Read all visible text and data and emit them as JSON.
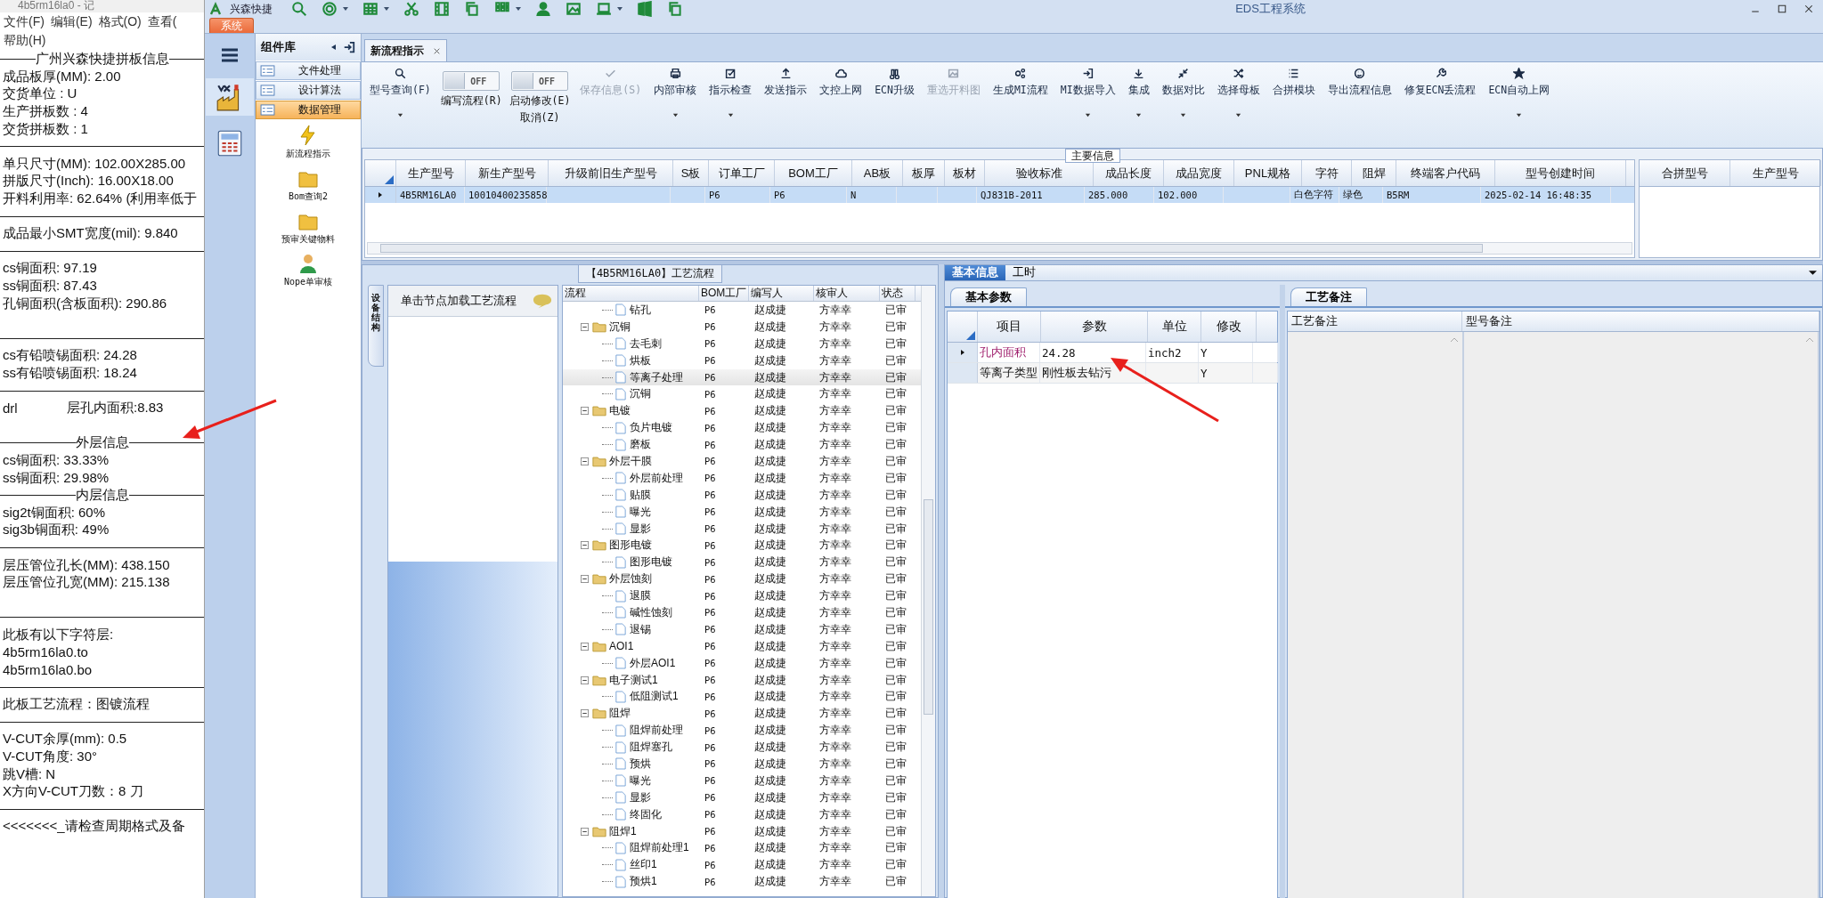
{
  "notepad": {
    "title": "4b5rm16la0 - 记",
    "menu": [
      "文件(F)",
      "编辑(E)",
      "格式(O)",
      "查看(",
      "帮助(H)"
    ],
    "lines": [
      {
        "kind": "heading",
        "text": "广州兴森快捷拼板信息"
      },
      {
        "kind": "text",
        "text": "成品板厚(MM): 2.00"
      },
      {
        "kind": "text",
        "text": "交货单位 : U"
      },
      {
        "kind": "text",
        "text": "生产拼板数 : 4"
      },
      {
        "kind": "text",
        "text": "交货拼板数 : 1"
      },
      {
        "kind": "rule"
      },
      {
        "kind": "text",
        "text": "单只尺寸(MM): 102.00X285.00"
      },
      {
        "kind": "text",
        "text": "拼版尺寸(Inch): 16.00X18.00"
      },
      {
        "kind": "text",
        "text": "开料利用率: 62.64% (利用率低于"
      },
      {
        "kind": "rule"
      },
      {
        "kind": "text",
        "text": "成品最小SMT宽度(mil): 9.840"
      },
      {
        "kind": "rule"
      },
      {
        "kind": "text",
        "text": "cs铜面积: 97.19"
      },
      {
        "kind": "text",
        "text": "ss铜面积: 87.43"
      },
      {
        "kind": "text",
        "text": "孔铜面积(含板面积): 290.86"
      },
      {
        "kind": "blank"
      },
      {
        "kind": "rule"
      },
      {
        "kind": "text",
        "text": "cs有铅喷锡面积: 24.28"
      },
      {
        "kind": "text",
        "text": "ss有铅喷锡面积: 18.24"
      },
      {
        "kind": "rule"
      },
      {
        "kind": "pair",
        "text": "drl",
        "value": "层孔内面积:8.83"
      },
      {
        "kind": "blank"
      },
      {
        "kind": "heading",
        "text": "外层信息"
      },
      {
        "kind": "text",
        "text": "cs铜面积: 33.33%"
      },
      {
        "kind": "text",
        "text": "ss铜面积: 29.98%"
      },
      {
        "kind": "heading",
        "text": "内层信息"
      },
      {
        "kind": "text",
        "text": "sig2t铜面积: 60%"
      },
      {
        "kind": "text",
        "text": "sig3b铜面积: 49%"
      },
      {
        "kind": "rule"
      },
      {
        "kind": "text",
        "text": "层压管位孔长(MM): 438.150"
      },
      {
        "kind": "text",
        "text": "层压管位孔宽(MM): 215.138"
      },
      {
        "kind": "blank"
      },
      {
        "kind": "rule"
      },
      {
        "kind": "text",
        "text": "此板有以下字符层:"
      },
      {
        "kind": "text",
        "text": "4b5rm16la0.to"
      },
      {
        "kind": "text",
        "text": "4b5rm16la0.bo"
      },
      {
        "kind": "rule"
      },
      {
        "kind": "text",
        "text": "此板工艺流程：图镀流程"
      },
      {
        "kind": "rule"
      },
      {
        "kind": "text",
        "text": "V-CUT余厚(mm): 0.5"
      },
      {
        "kind": "text",
        "text": "V-CUT角度: 30°"
      },
      {
        "kind": "text",
        "text": "跳V槽: N"
      },
      {
        "kind": "text",
        "text": "X方向V-CUT刀数：8 刀"
      },
      {
        "kind": "rule"
      },
      {
        "kind": "text",
        "text": "<<<<<<<_请检查周期格式及备"
      }
    ]
  },
  "app": {
    "brand": "兴森快捷",
    "title": "EDS工程系统",
    "system_tab": "系统"
  },
  "library": {
    "title": "组件库",
    "categories": [
      {
        "label": "文件处理",
        "selected": false
      },
      {
        "label": "设计算法",
        "selected": false
      },
      {
        "label": "数据管理",
        "selected": true
      }
    ],
    "tools": [
      "新流程指示",
      "Bom查询2",
      "预审关键物料",
      "Nope单审核"
    ]
  },
  "doc_tab": {
    "label": "新流程指示"
  },
  "ribbon": [
    {
      "kind": "button",
      "label": "型号查询(F)",
      "dropdown": true,
      "disabled": false
    },
    {
      "kind": "toggle",
      "switch_text": "OFF",
      "on": false,
      "label": "编写流程(R)"
    },
    {
      "kind": "toggle",
      "switch_text": "OFF",
      "on": false,
      "label": "启动修改(E)",
      "sublabel": "取消(Z)"
    },
    {
      "kind": "button",
      "label": "保存信息(S)",
      "dropdown": false,
      "disabled": true
    },
    {
      "kind": "button",
      "label": "内部审核",
      "dropdown": true,
      "disabled": false
    },
    {
      "kind": "button",
      "label": "指示检查",
      "dropdown": true,
      "disabled": false
    },
    {
      "kind": "button",
      "label": "发送指示",
      "dropdown": false,
      "disabled": false
    },
    {
      "kind": "button",
      "label": "文控上网",
      "dropdown": false,
      "disabled": false
    },
    {
      "kind": "button",
      "label": "ECN升级",
      "dropdown": false,
      "disabled": false
    },
    {
      "kind": "button",
      "label": "重选开料图",
      "dropdown": false,
      "disabled": true
    },
    {
      "kind": "button",
      "label": "生成MI流程",
      "dropdown": false,
      "disabled": false
    },
    {
      "kind": "button",
      "label": "MI数据导入",
      "dropdown": true,
      "disabled": false
    },
    {
      "kind": "button",
      "label": "集成",
      "dropdown": true,
      "disabled": false
    },
    {
      "kind": "button",
      "label": "数据对比",
      "dropdown": true,
      "disabled": false
    },
    {
      "kind": "button",
      "label": "选择母板",
      "dropdown": true,
      "disabled": false
    },
    {
      "kind": "button",
      "label": "合拼模块",
      "dropdown": false,
      "disabled": false
    },
    {
      "kind": "button",
      "label": "导出流程信息",
      "dropdown": false,
      "disabled": false
    },
    {
      "kind": "button",
      "label": "修复ECN丢流程",
      "dropdown": false,
      "disabled": false
    },
    {
      "kind": "button",
      "label": "ECN自动上网",
      "dropdown": true,
      "disabled": false
    }
  ],
  "main_info": {
    "title": "主要信息",
    "columns": [
      "生产型号",
      "新生产型号",
      "升级前旧生产型号",
      "S板",
      "订单工厂",
      "BOM工厂",
      "AB板",
      "板厚",
      "板材",
      "验收标准",
      "成品长度",
      "成品宽度",
      "PNL规格",
      "字符",
      "阻焊",
      "终端客户代码",
      "型号创建时间"
    ],
    "rows": [
      {
        "selected": true,
        "cells": [
          "4B5RM16LA0",
          "10010400235858",
          null,
          null,
          "P6",
          "P6",
          "N",
          null,
          null,
          "QJ831B-2011",
          "285.000",
          "102.000",
          null,
          "白色字符",
          "绿色",
          "B5RM",
          "2025-02-14 16:48:35"
        ]
      }
    ],
    "side_columns": [
      "合拼型号",
      "生产型号"
    ]
  },
  "process": {
    "title": "【4B5RM16LA0】工艺流程",
    "side_tab": "设备结构",
    "hint": "单击节点加载工艺流程",
    "columns": [
      "流程",
      "BOM工厂",
      "编写人",
      "核审人",
      "状态"
    ],
    "tree": [
      {
        "kind": "step",
        "name": "钻孔",
        "bom": "P6",
        "writer": "赵成捷",
        "reviewer": "方幸幸",
        "status": "已审",
        "selected": false
      },
      {
        "kind": "folder",
        "name": "沉铜",
        "bom": "P6",
        "writer": "赵成捷",
        "reviewer": "方幸幸",
        "status": "已审",
        "selected": false,
        "expanded": true,
        "children": [
          {
            "kind": "step",
            "name": "去毛刺",
            "bom": "P6",
            "writer": "赵成捷",
            "reviewer": "方幸幸",
            "status": "已审",
            "selected": false
          },
          {
            "kind": "step",
            "name": "烘板",
            "bom": "P6",
            "writer": "赵成捷",
            "reviewer": "方幸幸",
            "status": "已审",
            "selected": false
          },
          {
            "kind": "step",
            "name": "等离子处理",
            "bom": "P6",
            "writer": "赵成捷",
            "reviewer": "方幸幸",
            "status": "已审",
            "selected": true
          },
          {
            "kind": "step",
            "name": "沉铜",
            "bom": "P6",
            "writer": "赵成捷",
            "reviewer": "方幸幸",
            "status": "已审",
            "selected": false
          }
        ]
      },
      {
        "kind": "folder",
        "name": "电镀",
        "bom": "P6",
        "writer": "赵成捷",
        "reviewer": "方幸幸",
        "status": "已审",
        "selected": false,
        "expanded": true,
        "children": [
          {
            "kind": "step",
            "name": "负片电镀",
            "bom": "P6",
            "writer": "赵成捷",
            "reviewer": "方幸幸",
            "status": "已审",
            "selected": false
          },
          {
            "kind": "step",
            "name": "磨板",
            "bom": "P6",
            "writer": "赵成捷",
            "reviewer": "方幸幸",
            "status": "已审",
            "selected": false
          }
        ]
      },
      {
        "kind": "folder",
        "name": "外层干膜",
        "bom": "P6",
        "writer": "赵成捷",
        "reviewer": "方幸幸",
        "status": "已审",
        "selected": false,
        "expanded": true,
        "children": [
          {
            "kind": "step",
            "name": "外层前处理",
            "bom": "P6",
            "writer": "赵成捷",
            "reviewer": "方幸幸",
            "status": "已审",
            "selected": false
          },
          {
            "kind": "step",
            "name": "贴膜",
            "bom": "P6",
            "writer": "赵成捷",
            "reviewer": "方幸幸",
            "status": "已审",
            "selected": false
          },
          {
            "kind": "step",
            "name": "曝光",
            "bom": "P6",
            "writer": "赵成捷",
            "reviewer": "方幸幸",
            "status": "已审",
            "selected": false
          },
          {
            "kind": "step",
            "name": "显影",
            "bom": "P6",
            "writer": "赵成捷",
            "reviewer": "方幸幸",
            "status": "已审",
            "selected": false
          }
        ]
      },
      {
        "kind": "folder",
        "name": "图形电镀",
        "bom": "P6",
        "writer": "赵成捷",
        "reviewer": "方幸幸",
        "status": "已审",
        "selected": false,
        "expanded": true,
        "children": [
          {
            "kind": "step",
            "name": "图形电镀",
            "bom": "P6",
            "writer": "赵成捷",
            "reviewer": "方幸幸",
            "status": "已审",
            "selected": false
          }
        ]
      },
      {
        "kind": "folder",
        "name": "外层蚀刻",
        "bom": "P6",
        "writer": "赵成捷",
        "reviewer": "方幸幸",
        "status": "已审",
        "selected": false,
        "expanded": true,
        "children": [
          {
            "kind": "step",
            "name": "退膜",
            "bom": "P6",
            "writer": "赵成捷",
            "reviewer": "方幸幸",
            "status": "已审",
            "selected": false
          },
          {
            "kind": "step",
            "name": "碱性蚀刻",
            "bom": "P6",
            "writer": "赵成捷",
            "reviewer": "方幸幸",
            "status": "已审",
            "selected": false
          },
          {
            "kind": "step",
            "name": "退锡",
            "bom": "P6",
            "writer": "赵成捷",
            "reviewer": "方幸幸",
            "status": "已审",
            "selected": false
          }
        ]
      },
      {
        "kind": "folder",
        "name": "AOI1",
        "bom": "P6",
        "writer": "赵成捷",
        "reviewer": "方幸幸",
        "status": "已审",
        "selected": false,
        "expanded": true,
        "children": [
          {
            "kind": "step",
            "name": "外层AOI1",
            "bom": "P6",
            "writer": "赵成捷",
            "reviewer": "方幸幸",
            "status": "已审",
            "selected": false
          }
        ]
      },
      {
        "kind": "folder",
        "name": "电子测试1",
        "bom": "P6",
        "writer": "赵成捷",
        "reviewer": "方幸幸",
        "status": "已审",
        "selected": false,
        "expanded": true,
        "children": [
          {
            "kind": "step",
            "name": "低阻测试1",
            "bom": "P6",
            "writer": "赵成捷",
            "reviewer": "方幸幸",
            "status": "已审",
            "selected": false
          }
        ]
      },
      {
        "kind": "folder",
        "name": "阻焊",
        "bom": "P6",
        "writer": "赵成捷",
        "reviewer": "方幸幸",
        "status": "已审",
        "selected": false,
        "expanded": true,
        "children": [
          {
            "kind": "step",
            "name": "阻焊前处理",
            "bom": "P6",
            "writer": "赵成捷",
            "reviewer": "方幸幸",
            "status": "已审",
            "selected": false
          },
          {
            "kind": "step",
            "name": "阻焊塞孔",
            "bom": "P6",
            "writer": "赵成捷",
            "reviewer": "方幸幸",
            "status": "已审",
            "selected": false
          },
          {
            "kind": "step",
            "name": "预烘",
            "bom": "P6",
            "writer": "赵成捷",
            "reviewer": "方幸幸",
            "status": "已审",
            "selected": false
          },
          {
            "kind": "step",
            "name": "曝光",
            "bom": "P6",
            "writer": "赵成捷",
            "reviewer": "方幸幸",
            "status": "已审",
            "selected": false
          },
          {
            "kind": "step",
            "name": "显影",
            "bom": "P6",
            "writer": "赵成捷",
            "reviewer": "方幸幸",
            "status": "已审",
            "selected": false
          },
          {
            "kind": "step",
            "name": "终固化",
            "bom": "P6",
            "writer": "赵成捷",
            "reviewer": "方幸幸",
            "status": "已审",
            "selected": false
          }
        ]
      },
      {
        "kind": "folder",
        "name": "阻焊1",
        "bom": "P6",
        "writer": "赵成捷",
        "reviewer": "方幸幸",
        "status": "已审",
        "selected": false,
        "expanded": true,
        "children": [
          {
            "kind": "step",
            "name": "阻焊前处理1",
            "bom": "P6",
            "writer": "赵成捷",
            "reviewer": "方幸幸",
            "status": "已审",
            "selected": false
          },
          {
            "kind": "step",
            "name": "丝印1",
            "bom": "P6",
            "writer": "赵成捷",
            "reviewer": "方幸幸",
            "status": "已审",
            "selected": false
          },
          {
            "kind": "step",
            "name": "预烘1",
            "bom": "P6",
            "writer": "赵成捷",
            "reviewer": "方幸幸",
            "status": "已审",
            "selected": false
          }
        ]
      }
    ]
  },
  "detail": {
    "tabs": [
      {
        "label": "基本信息",
        "selected": true
      },
      {
        "label": "工时",
        "selected": false
      }
    ],
    "params": {
      "tab": "基本参数",
      "columns": [
        "项目",
        "参数",
        "单位",
        "修改"
      ],
      "rows": [
        {
          "selected": true,
          "changed": true,
          "cells": [
            "孔内面积",
            "24.28",
            "inch2",
            "Y"
          ]
        },
        {
          "selected": false,
          "changed": false,
          "cells": [
            "等离子类型",
            "刚性板去钻污",
            null,
            "Y"
          ]
        }
      ]
    },
    "notes": {
      "tab": "工艺备注",
      "columns": [
        "工艺备注",
        "型号备注"
      ]
    }
  }
}
